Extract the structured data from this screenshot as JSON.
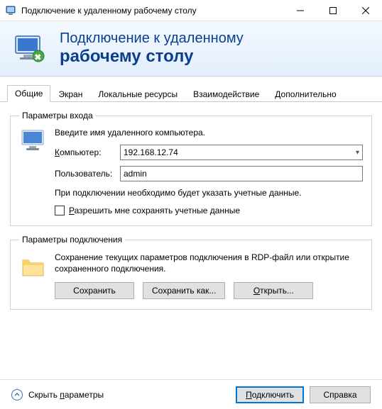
{
  "window": {
    "title": "Подключение к удаленному рабочему столу"
  },
  "header": {
    "line1": "Подключение к удаленному",
    "line2": "рабочему столу"
  },
  "tabs": {
    "general": "Общие",
    "display": "Экран",
    "local": "Локальные ресурсы",
    "experience": "Взаимодействие",
    "advanced": "Дополнительно"
  },
  "login_group": {
    "legend": "Параметры входа",
    "instruction": "Введите имя удаленного компьютера.",
    "computer_label_pre": "К",
    "computer_label_rest": "омпьютер:",
    "computer_value": "192.168.12.74",
    "user_label": "Пользователь:",
    "user_value": "admin",
    "note": "При подключении необходимо будет указать учетные данные.",
    "save_creds_pre": "Р",
    "save_creds_rest": "азрешить мне сохранять учетные данные"
  },
  "conn_group": {
    "legend": "Параметры подключения",
    "desc": "Сохранение текущих параметров подключения в RDP-файл или открытие сохраненного подключения.",
    "save": "Сохранить",
    "save_as": "Сохранить как...",
    "open_pre": "О",
    "open_rest": "ткрыть..."
  },
  "footer": {
    "toggle_pre": "Скрыть ",
    "toggle_ul": "п",
    "toggle_rest": "араметры",
    "connect_pre": "П",
    "connect_rest": "одключить",
    "help": "Справка"
  }
}
